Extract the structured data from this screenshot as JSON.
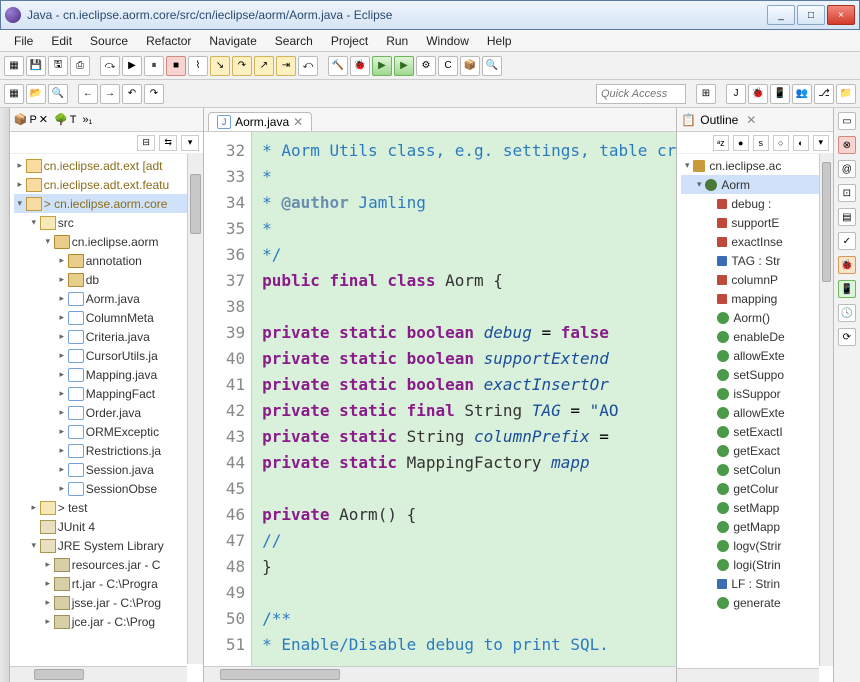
{
  "window": {
    "title": "Java - cn.ieclipse.aorm.core/src/cn/ieclipse/aorm/Aorm.java - Eclipse",
    "min": "_",
    "max": "□",
    "close": "×"
  },
  "menu": [
    "File",
    "Edit",
    "Source",
    "Refactor",
    "Navigate",
    "Search",
    "Project",
    "Run",
    "Window",
    "Help"
  ],
  "quick_access_placeholder": "Quick Access",
  "pexp": {
    "tabs": {
      "p": "P",
      "t": "T"
    },
    "tree": [
      {
        "d": 0,
        "tw": "▸",
        "ic": "proj",
        "lbl": "cn.ieclipse.adt.ext",
        "sfx": " [adt",
        "warn": true
      },
      {
        "d": 0,
        "tw": "▸",
        "ic": "proj",
        "lbl": "cn.ieclipse.adt.ext.featu",
        "warn": true
      },
      {
        "d": 0,
        "tw": "▾",
        "ic": "proj",
        "lbl": "> cn.ieclipse.aorm.core",
        "warn": true,
        "sel": true
      },
      {
        "d": 1,
        "tw": "▾",
        "ic": "fold",
        "lbl": "src"
      },
      {
        "d": 2,
        "tw": "▾",
        "ic": "pkg",
        "lbl": "cn.ieclipse.aorm"
      },
      {
        "d": 3,
        "tw": "▸",
        "ic": "pkg",
        "lbl": "annotation"
      },
      {
        "d": 3,
        "tw": "▸",
        "ic": "pkg",
        "lbl": "db"
      },
      {
        "d": 3,
        "tw": "▸",
        "ic": "cls",
        "lbl": "Aorm.java"
      },
      {
        "d": 3,
        "tw": "▸",
        "ic": "cls",
        "lbl": "ColumnMeta"
      },
      {
        "d": 3,
        "tw": "▸",
        "ic": "cls",
        "lbl": "Criteria.java"
      },
      {
        "d": 3,
        "tw": "▸",
        "ic": "cls",
        "lbl": "CursorUtils.ja"
      },
      {
        "d": 3,
        "tw": "▸",
        "ic": "cls",
        "lbl": "Mapping.java"
      },
      {
        "d": 3,
        "tw": "▸",
        "ic": "cls",
        "lbl": "MappingFact"
      },
      {
        "d": 3,
        "tw": "▸",
        "ic": "cls",
        "lbl": "Order.java"
      },
      {
        "d": 3,
        "tw": "▸",
        "ic": "cls",
        "lbl": "ORMExceptic"
      },
      {
        "d": 3,
        "tw": "▸",
        "ic": "cls",
        "lbl": "Restrictions.ja"
      },
      {
        "d": 3,
        "tw": "▸",
        "ic": "cls",
        "lbl": "Session.java"
      },
      {
        "d": 3,
        "tw": "▸",
        "ic": "cls",
        "lbl": "SessionObse"
      },
      {
        "d": 1,
        "tw": "▸",
        "ic": "fold",
        "lbl": "> test"
      },
      {
        "d": 1,
        "tw": "",
        "ic": "lib",
        "lbl": "JUnit 4"
      },
      {
        "d": 1,
        "tw": "▾",
        "ic": "lib",
        "lbl": "JRE System Library"
      },
      {
        "d": 2,
        "tw": "▸",
        "ic": "jar",
        "lbl": "resources.jar - C"
      },
      {
        "d": 2,
        "tw": "▸",
        "ic": "jar",
        "lbl": "rt.jar - C:\\Progra"
      },
      {
        "d": 2,
        "tw": "▸",
        "ic": "jar",
        "lbl": "jsse.jar - C:\\Prog"
      },
      {
        "d": 2,
        "tw": "▸",
        "ic": "jar",
        "lbl": "jce.jar - C:\\Prog"
      }
    ]
  },
  "editor": {
    "tab_label": "Aorm.java",
    "tab_close": "✕",
    "line_nums": [
      "32",
      "33",
      "34",
      "35",
      "36",
      "37",
      "38",
      "39",
      "40",
      "41",
      "42",
      "43",
      "44",
      "45",
      "46",
      "47",
      "48",
      "49",
      "50",
      "51"
    ],
    "lines": [
      [
        {
          "t": " * ",
          "c": "cmt"
        },
        {
          "t": "Aorm Utils class, e.g. settings, table cr",
          "c": "cmt"
        }
      ],
      [
        {
          "t": " *",
          "c": "cmt"
        }
      ],
      [
        {
          "t": " * ",
          "c": "cmt"
        },
        {
          "t": "@author",
          "c": "doctag"
        },
        {
          "t": " Jamling",
          "c": "cmt"
        }
      ],
      [
        {
          "t": " *",
          "c": "cmt"
        }
      ],
      [
        {
          "t": " */",
          "c": "cmt"
        }
      ],
      [
        {
          "t": "public final class ",
          "c": "kw"
        },
        {
          "t": "Aorm {",
          "c": "clsname"
        }
      ],
      [
        {
          "t": "",
          "c": ""
        }
      ],
      [
        {
          "t": "    ",
          "c": ""
        },
        {
          "t": "private static boolean ",
          "c": "kw"
        },
        {
          "t": "debug",
          "c": "fld"
        },
        {
          "t": " = ",
          "c": ""
        },
        {
          "t": "false",
          "c": "kw"
        }
      ],
      [
        {
          "t": "    ",
          "c": ""
        },
        {
          "t": "private static boolean ",
          "c": "kw"
        },
        {
          "t": "supportExtend",
          "c": "fld"
        }
      ],
      [
        {
          "t": "    ",
          "c": ""
        },
        {
          "t": "private static boolean ",
          "c": "kw"
        },
        {
          "t": "exactInsertOr",
          "c": "fld"
        }
      ],
      [
        {
          "t": "    ",
          "c": ""
        },
        {
          "t": "private static final ",
          "c": "kw"
        },
        {
          "t": "String ",
          "c": "clsname"
        },
        {
          "t": "TAG",
          "c": "fld"
        },
        {
          "t": " = ",
          "c": ""
        },
        {
          "t": "\"AO",
          "c": "str"
        }
      ],
      [
        {
          "t": "    ",
          "c": ""
        },
        {
          "t": "private static ",
          "c": "kw"
        },
        {
          "t": "String ",
          "c": "clsname"
        },
        {
          "t": "columnPrefix",
          "c": "fld"
        },
        {
          "t": " = ",
          "c": ""
        }
      ],
      [
        {
          "t": "    ",
          "c": ""
        },
        {
          "t": "private static ",
          "c": "kw"
        },
        {
          "t": "MappingFactory ",
          "c": "clsname"
        },
        {
          "t": "mapp",
          "c": "fld"
        }
      ],
      [
        {
          "t": "",
          "c": ""
        }
      ],
      [
        {
          "t": "    ",
          "c": ""
        },
        {
          "t": "private ",
          "c": "kw"
        },
        {
          "t": "Aorm() {",
          "c": "clsname"
        }
      ],
      [
        {
          "t": "        ",
          "c": ""
        },
        {
          "t": "//",
          "c": "cmt"
        }
      ],
      [
        {
          "t": "    }",
          "c": "clsname"
        }
      ],
      [
        {
          "t": "",
          "c": ""
        }
      ],
      [
        {
          "t": "    ",
          "c": ""
        },
        {
          "t": "/**",
          "c": "cmt"
        }
      ],
      [
        {
          "t": "     * ",
          "c": "cmt"
        },
        {
          "t": "Enable/Disable debug to print SQL.",
          "c": "cmt"
        }
      ]
    ]
  },
  "outline": {
    "title": "Outline",
    "pkg": "cn.ieclipse.ac",
    "cls": "Aorm",
    "members": [
      {
        "ic": "sf",
        "lbl": "debug : "
      },
      {
        "ic": "sf",
        "lbl": "supportE"
      },
      {
        "ic": "sf",
        "lbl": "exactInse"
      },
      {
        "ic": "sfc",
        "lbl": "TAG : Str"
      },
      {
        "ic": "sf",
        "lbl": "columnP"
      },
      {
        "ic": "sf",
        "lbl": "mapping"
      },
      {
        "ic": "ctor",
        "lbl": "Aorm()"
      },
      {
        "ic": "pub",
        "lbl": "enableDe"
      },
      {
        "ic": "pub",
        "lbl": "allowExte"
      },
      {
        "ic": "pub",
        "lbl": "setSuppo"
      },
      {
        "ic": "pub",
        "lbl": "isSuppor"
      },
      {
        "ic": "pub",
        "lbl": "allowExte"
      },
      {
        "ic": "pub",
        "lbl": "setExactI"
      },
      {
        "ic": "sta",
        "lbl": "getExact"
      },
      {
        "ic": "pub",
        "lbl": "setColun"
      },
      {
        "ic": "pub",
        "lbl": "getColur"
      },
      {
        "ic": "pub",
        "lbl": "setMapp"
      },
      {
        "ic": "pub",
        "lbl": "getMapp"
      },
      {
        "ic": "pub",
        "lbl": "logv(Strir"
      },
      {
        "ic": "pub",
        "lbl": "logi(Strin"
      },
      {
        "ic": "sfc",
        "lbl": "LF : Strin"
      },
      {
        "ic": "pub",
        "lbl": "generate"
      }
    ]
  }
}
